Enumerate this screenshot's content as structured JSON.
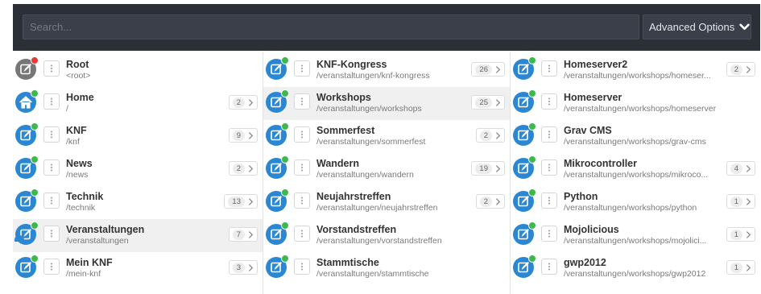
{
  "search": {
    "placeholder": "Search..."
  },
  "advanced_options": {
    "label": "Advanced Options"
  },
  "colors": {
    "page_icon": "#2b87d1",
    "root_icon": "#777777",
    "status_published": "#3cb94b",
    "status_error": "#e53935"
  },
  "columns": [
    {
      "items": [
        {
          "title": "Root",
          "route": "<root>",
          "icon": "page-icon",
          "status": "red"
        },
        {
          "title": "Home",
          "route": "/",
          "icon": "home-icon",
          "status": "green",
          "count": "2"
        },
        {
          "title": "KNF",
          "route": "/knf",
          "icon": "page-icon",
          "status": "green",
          "count": "9"
        },
        {
          "title": "News",
          "route": "/news",
          "icon": "page-icon",
          "status": "green",
          "count": "2"
        },
        {
          "title": "Technik",
          "route": "/technik",
          "icon": "page-icon",
          "status": "green",
          "count": "13"
        },
        {
          "title": "Veranstaltungen",
          "route": "/veranstaltungen",
          "icon": "page-icon",
          "status": "green",
          "count": "7",
          "selected": true
        },
        {
          "title": "Mein KNF",
          "route": "/mein-knf",
          "icon": "page-icon",
          "status": "green",
          "count": "3"
        }
      ]
    },
    {
      "items": [
        {
          "title": "KNF-Kongress",
          "route": "/veranstaltungen/knf-kongress",
          "icon": "page-icon",
          "status": "green",
          "count": "26"
        },
        {
          "title": "Workshops",
          "route": "/veranstaltungen/workshops",
          "icon": "page-icon",
          "status": "green",
          "count": "25",
          "selected": true
        },
        {
          "title": "Sommerfest",
          "route": "/veranstaltungen/sommerfest",
          "icon": "page-icon",
          "status": "green",
          "count": "2"
        },
        {
          "title": "Wandern",
          "route": "/veranstaltungen/wandern",
          "icon": "page-icon",
          "status": "green",
          "count": "19"
        },
        {
          "title": "Neujahrstreffen",
          "route": "/veranstaltungen/neujahrstreffen",
          "icon": "page-icon",
          "status": "green",
          "count": "2"
        },
        {
          "title": "Vorstandstreffen",
          "route": "/veranstaltungen/vorstandstreffen",
          "icon": "page-icon",
          "status": "green"
        },
        {
          "title": "Stammtische",
          "route": "/veranstaltungen/stammtische",
          "icon": "page-icon",
          "status": "green"
        }
      ]
    },
    {
      "items": [
        {
          "title": "Homeserver2",
          "route": "/veranstaltungen/workshops/homeser...",
          "icon": "page-icon",
          "status": "green",
          "count": "2"
        },
        {
          "title": "Homeserver",
          "route": "/veranstaltungen/workshops/homeserver",
          "icon": "page-icon",
          "status": "green"
        },
        {
          "title": "Grav CMS",
          "route": "/veranstaltungen/workshops/grav-cms",
          "icon": "page-icon",
          "status": "green"
        },
        {
          "title": "Mikrocontroller",
          "route": "/veranstaltungen/workshops/mikroco...",
          "icon": "page-icon",
          "status": "green",
          "count": "4"
        },
        {
          "title": "Python",
          "route": "/veranstaltungen/workshops/python",
          "icon": "page-icon",
          "status": "green",
          "count": "1"
        },
        {
          "title": "Mojolicious",
          "route": "/veranstaltungen/workshops/mojolici...",
          "icon": "page-icon",
          "status": "green",
          "count": "1"
        },
        {
          "title": "gwp2012",
          "route": "/veranstaltungen/workshops/gwp2012",
          "icon": "page-icon",
          "status": "green",
          "count": "1"
        }
      ]
    }
  ]
}
